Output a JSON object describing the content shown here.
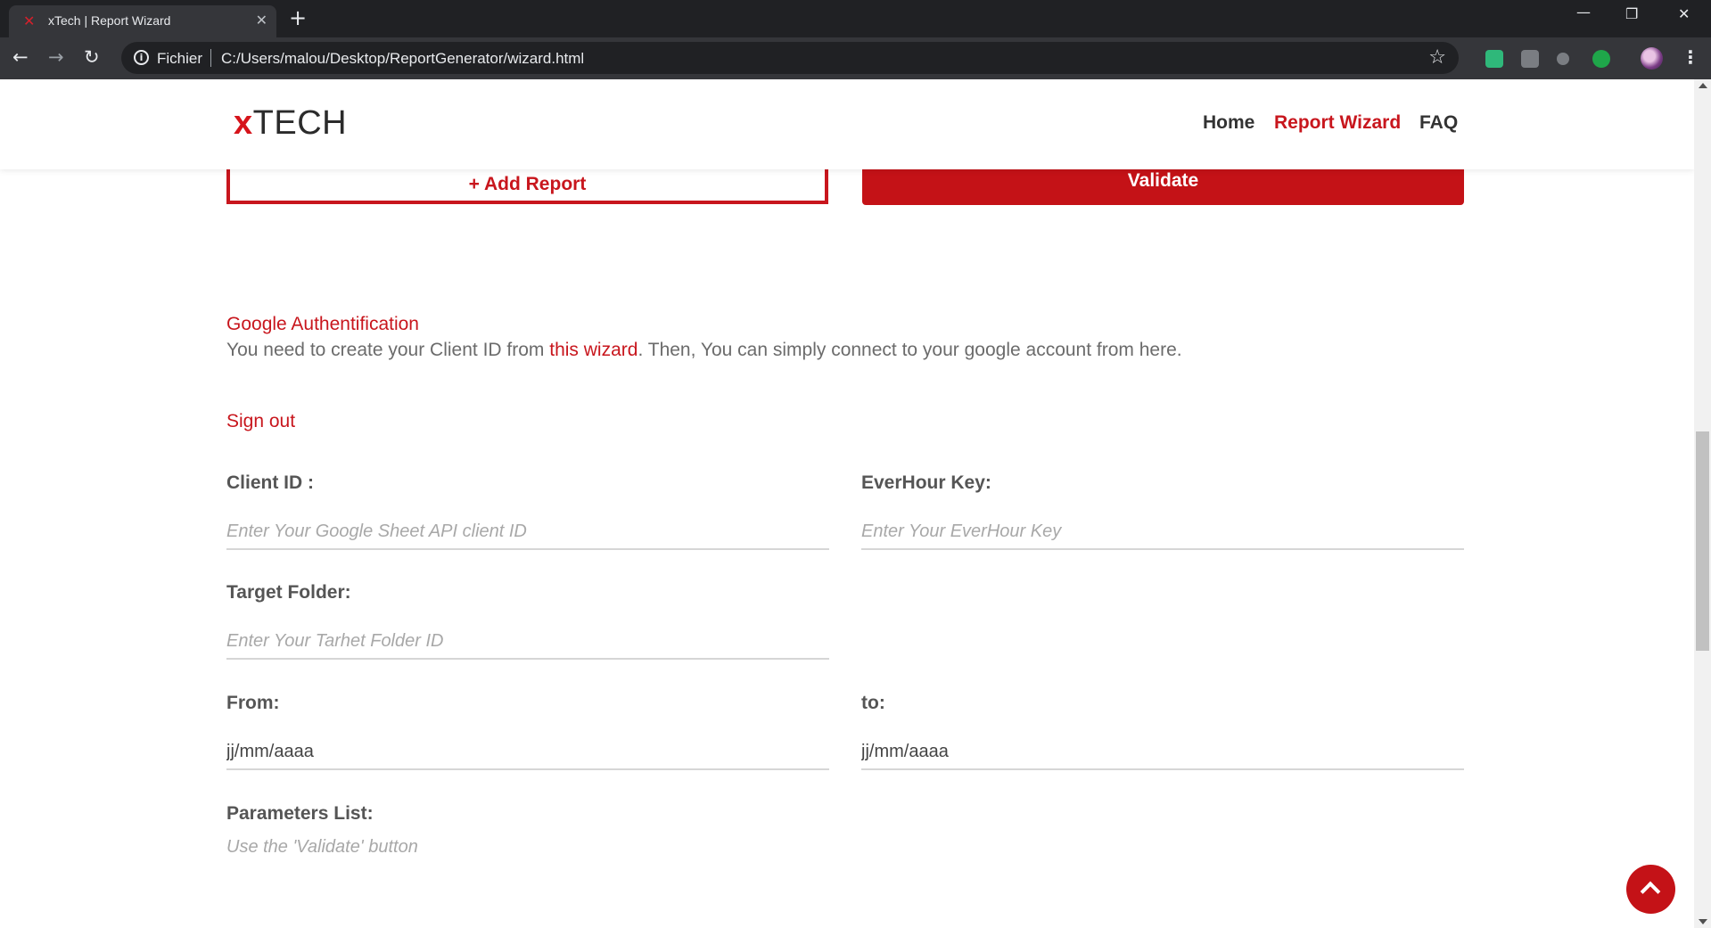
{
  "browser": {
    "tab_title": "xTech | Report Wizard",
    "tab_favicon": "✕",
    "url_scheme_label": "Fichier",
    "url": "C:/Users/malou/Desktop/ReportGenerator/wizard.html"
  },
  "site": {
    "logo_x": "x",
    "logo_text": "TECH",
    "nav": [
      {
        "label": "Home"
      },
      {
        "label": "Report Wizard",
        "active": true
      },
      {
        "label": "FAQ"
      }
    ]
  },
  "actions": {
    "add_report": "+ Add Report",
    "validate": "Validate"
  },
  "auth": {
    "title": "Google Authentification",
    "desc_before": "You need to create your Client ID from ",
    "desc_link": "this wizard",
    "desc_after": ". Then, You can simply connect to your google account from here.",
    "sign_out": "Sign out"
  },
  "form": {
    "client_id_label": "Client ID :",
    "client_id_placeholder": "Enter Your Google Sheet API client ID",
    "everhour_label": "EverHour Key:",
    "everhour_placeholder": "Enter Your EverHour Key",
    "target_folder_label": "Target Folder:",
    "target_folder_placeholder": "Enter Your Tarhet Folder ID",
    "from_label": "From:",
    "from_value": "jj/mm/aaaa",
    "to_label": "to:",
    "to_value": "jj/mm/aaaa",
    "params_label": "Parameters List:",
    "params_hint": "Use the 'Validate' button"
  },
  "colors": {
    "brand_red": "#c8161d",
    "text_gray": "#555555"
  }
}
